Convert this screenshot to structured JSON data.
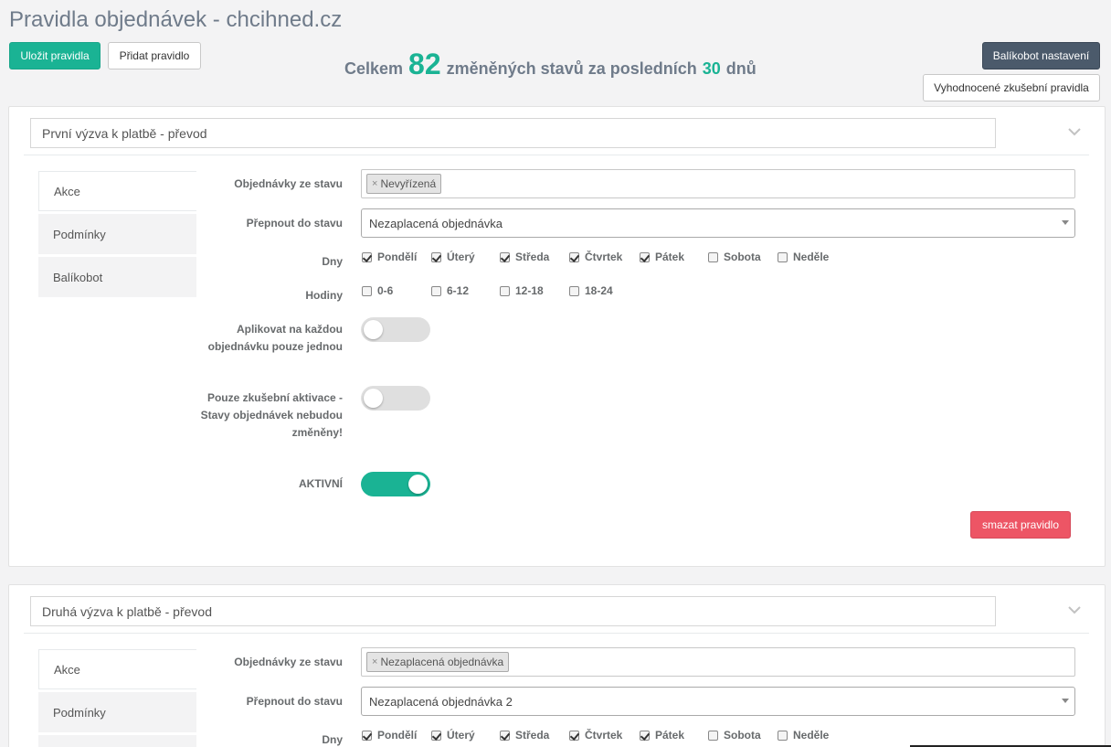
{
  "header": {
    "title": "Pravidla objednávek - chcihned.cz",
    "save_label": "Uložit pravidla",
    "add_label": "Přidat pravidlo",
    "settings_label": "Balíkobot nastavení",
    "evaluated_label": "Vyhodnocené zkušební pravidla"
  },
  "summary": {
    "prefix": "Celkem",
    "count": "82",
    "middle": "změněných stavů za posledních",
    "days": "30",
    "suffix": "dnů"
  },
  "labels": {
    "from_status": "Objednávky ze stavu",
    "to_status": "Přepnout do stavu",
    "days": "Dny",
    "hours": "Hodiny",
    "apply_once": "Aplikovat na každou objednávku pouze jednou",
    "trial_only": "Pouze zkušební aktivace - Stavy objednávek nebudou změněny!",
    "active": "AKTIVNÍ",
    "delete": "smazat pravidlo"
  },
  "tabs": [
    "Akce",
    "Podmínky",
    "Balíkobot"
  ],
  "days": [
    "Pondělí",
    "Úterý",
    "Středa",
    "Čtvrtek",
    "Pátek",
    "Sobota",
    "Neděle"
  ],
  "hours": [
    "0-6",
    "6-12",
    "12-18",
    "18-24"
  ],
  "rules": [
    {
      "name": "První výzva k platbě - převod",
      "from_tag": "Nevyřízená",
      "to_status": "Nezaplacená objednávka",
      "days_checked": [
        true,
        true,
        true,
        true,
        true,
        false,
        false
      ],
      "hours_checked": [
        false,
        false,
        false,
        false
      ],
      "apply_once": false,
      "trial_only": false,
      "active": true
    },
    {
      "name": "Druhá výzva k platbě - převod",
      "from_tag": "Nezaplacená objednávka",
      "to_status": "Nezaplacená objednávka 2",
      "days_checked": [
        true,
        true,
        true,
        true,
        true,
        false,
        false
      ]
    }
  ],
  "colors": {
    "accent": "#1ab394",
    "danger": "#ed5565",
    "dark_button": "#4b5a6b"
  },
  "icons": {
    "collapse": "chevron-down-icon",
    "tag_remove": "close-icon",
    "select": "caret-down-icon"
  }
}
